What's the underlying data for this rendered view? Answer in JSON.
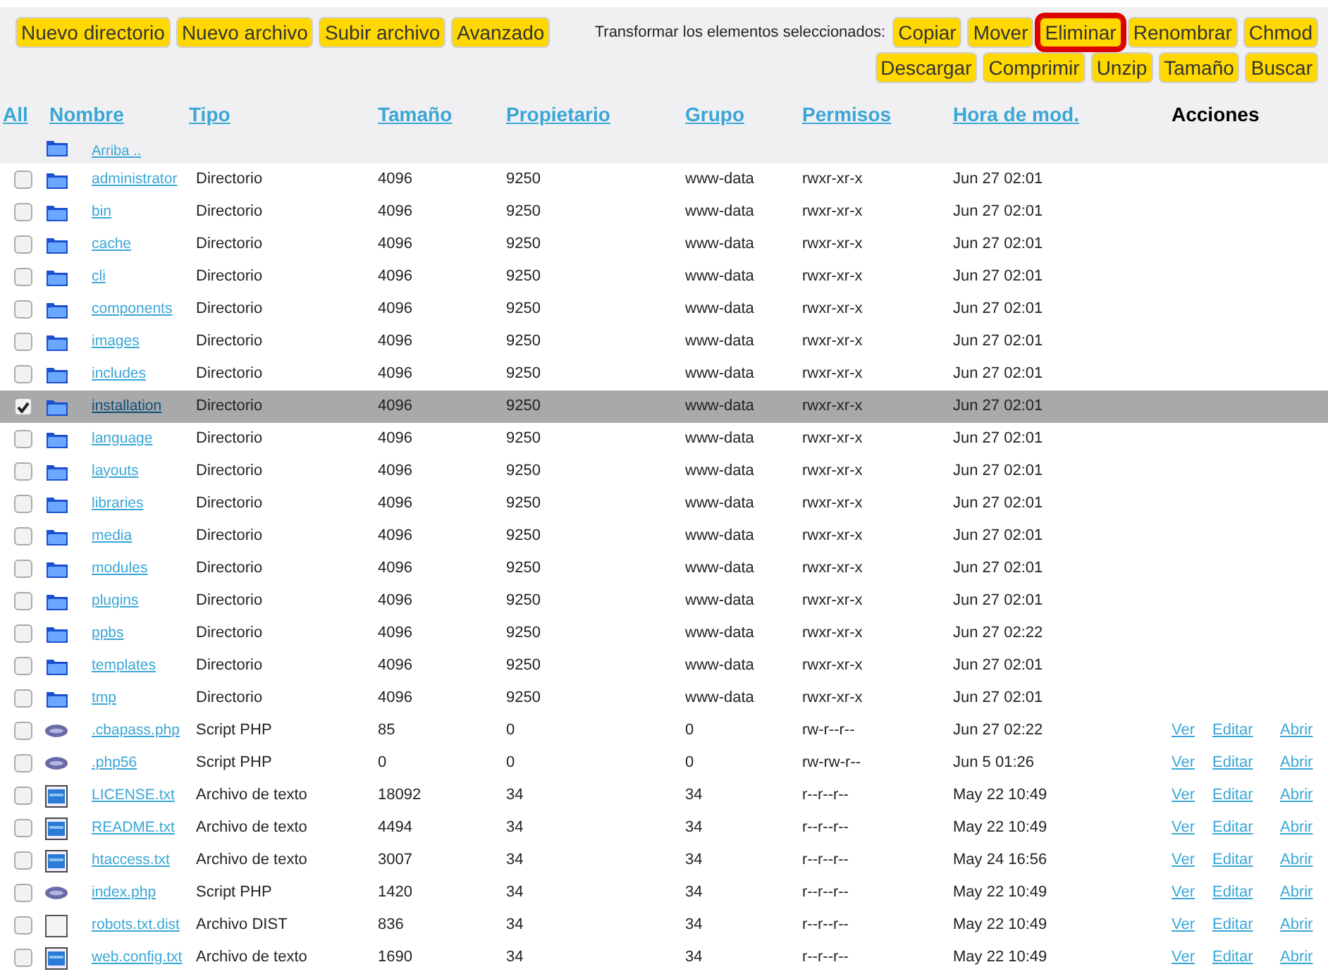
{
  "toolbar": {
    "left_buttons": [
      {
        "label": "Nuevo directorio",
        "highlighted": false
      },
      {
        "label": "Nuevo archivo",
        "highlighted": false
      },
      {
        "label": "Subir archivo",
        "highlighted": false
      },
      {
        "label": "Avanzado",
        "highlighted": false
      }
    ],
    "transform_label": "Transformar los elementos seleccionados:",
    "right_buttons_row1": [
      {
        "label": "Copiar",
        "highlighted": false
      },
      {
        "label": "Mover",
        "highlighted": false
      },
      {
        "label": "Eliminar",
        "highlighted": true
      },
      {
        "label": "Renombrar",
        "highlighted": false
      },
      {
        "label": "Chmod",
        "highlighted": false
      }
    ],
    "right_buttons_row2": [
      {
        "label": "Descargar",
        "highlighted": false
      },
      {
        "label": "Comprimir",
        "highlighted": false
      },
      {
        "label": "Unzip",
        "highlighted": false
      },
      {
        "label": "Tamaño",
        "highlighted": false
      },
      {
        "label": "Buscar",
        "highlighted": false
      }
    ]
  },
  "table": {
    "columns": [
      "All",
      "Nombre",
      "Tipo",
      "Tamaño",
      "Propietario",
      "Grupo",
      "Permisos",
      "Hora de mod.",
      "Acciones"
    ],
    "up_link": "Arriba ..",
    "rows": [
      {
        "kind": "dir",
        "checked": false,
        "name": "administrator",
        "type": "Directorio",
        "size": "4096",
        "owner": "9250",
        "group": "www-data",
        "perms": "rwxr-xr-x",
        "time": "Jun 27 02:01",
        "actions": []
      },
      {
        "kind": "dir",
        "checked": false,
        "name": "bin",
        "type": "Directorio",
        "size": "4096",
        "owner": "9250",
        "group": "www-data",
        "perms": "rwxr-xr-x",
        "time": "Jun 27 02:01",
        "actions": []
      },
      {
        "kind": "dir",
        "checked": false,
        "name": "cache",
        "type": "Directorio",
        "size": "4096",
        "owner": "9250",
        "group": "www-data",
        "perms": "rwxr-xr-x",
        "time": "Jun 27 02:01",
        "actions": []
      },
      {
        "kind": "dir",
        "checked": false,
        "name": "cli",
        "type": "Directorio",
        "size": "4096",
        "owner": "9250",
        "group": "www-data",
        "perms": "rwxr-xr-x",
        "time": "Jun 27 02:01",
        "actions": []
      },
      {
        "kind": "dir",
        "checked": false,
        "name": "components",
        "type": "Directorio",
        "size": "4096",
        "owner": "9250",
        "group": "www-data",
        "perms": "rwxr-xr-x",
        "time": "Jun 27 02:01",
        "actions": []
      },
      {
        "kind": "dir",
        "checked": false,
        "name": "images",
        "type": "Directorio",
        "size": "4096",
        "owner": "9250",
        "group": "www-data",
        "perms": "rwxr-xr-x",
        "time": "Jun 27 02:01",
        "actions": []
      },
      {
        "kind": "dir",
        "checked": false,
        "name": "includes",
        "type": "Directorio",
        "size": "4096",
        "owner": "9250",
        "group": "www-data",
        "perms": "rwxr-xr-x",
        "time": "Jun 27 02:01",
        "actions": []
      },
      {
        "kind": "dir",
        "checked": true,
        "name": "installation",
        "type": "Directorio",
        "size": "4096",
        "owner": "9250",
        "group": "www-data",
        "perms": "rwxr-xr-x",
        "time": "Jun 27 02:01",
        "actions": []
      },
      {
        "kind": "dir",
        "checked": false,
        "name": "language",
        "type": "Directorio",
        "size": "4096",
        "owner": "9250",
        "group": "www-data",
        "perms": "rwxr-xr-x",
        "time": "Jun 27 02:01",
        "actions": []
      },
      {
        "kind": "dir",
        "checked": false,
        "name": "layouts",
        "type": "Directorio",
        "size": "4096",
        "owner": "9250",
        "group": "www-data",
        "perms": "rwxr-xr-x",
        "time": "Jun 27 02:01",
        "actions": []
      },
      {
        "kind": "dir",
        "checked": false,
        "name": "libraries",
        "type": "Directorio",
        "size": "4096",
        "owner": "9250",
        "group": "www-data",
        "perms": "rwxr-xr-x",
        "time": "Jun 27 02:01",
        "actions": []
      },
      {
        "kind": "dir",
        "checked": false,
        "name": "media",
        "type": "Directorio",
        "size": "4096",
        "owner": "9250",
        "group": "www-data",
        "perms": "rwxr-xr-x",
        "time": "Jun 27 02:01",
        "actions": []
      },
      {
        "kind": "dir",
        "checked": false,
        "name": "modules",
        "type": "Directorio",
        "size": "4096",
        "owner": "9250",
        "group": "www-data",
        "perms": "rwxr-xr-x",
        "time": "Jun 27 02:01",
        "actions": []
      },
      {
        "kind": "dir",
        "checked": false,
        "name": "plugins",
        "type": "Directorio",
        "size": "4096",
        "owner": "9250",
        "group": "www-data",
        "perms": "rwxr-xr-x",
        "time": "Jun 27 02:01",
        "actions": []
      },
      {
        "kind": "dir",
        "checked": false,
        "name": "ppbs",
        "type": "Directorio",
        "size": "4096",
        "owner": "9250",
        "group": "www-data",
        "perms": "rwxr-xr-x",
        "time": "Jun 27 02:22",
        "actions": []
      },
      {
        "kind": "dir",
        "checked": false,
        "name": "templates",
        "type": "Directorio",
        "size": "4096",
        "owner": "9250",
        "group": "www-data",
        "perms": "rwxr-xr-x",
        "time": "Jun 27 02:01",
        "actions": []
      },
      {
        "kind": "dir",
        "checked": false,
        "name": "tmp",
        "type": "Directorio",
        "size": "4096",
        "owner": "9250",
        "group": "www-data",
        "perms": "rwxr-xr-x",
        "time": "Jun 27 02:01",
        "actions": []
      },
      {
        "kind": "php",
        "checked": false,
        "name": ".cbapass.php",
        "type": "Script PHP",
        "size": "85",
        "owner": "0",
        "group": "0",
        "perms": "rw-r--r--",
        "time": "Jun 27 02:22",
        "actions": [
          "Ver",
          "Editar",
          "Abrir"
        ]
      },
      {
        "kind": "php",
        "checked": false,
        "name": ".php56",
        "type": "Script PHP",
        "size": "0",
        "owner": "0",
        "group": "0",
        "perms": "rw-rw-r--",
        "time": "Jun 5 01:26",
        "actions": [
          "Ver",
          "Editar",
          "Abrir"
        ]
      },
      {
        "kind": "text",
        "checked": false,
        "name": "LICENSE.txt",
        "type": "Archivo de texto",
        "size": "18092",
        "owner": "34",
        "group": "34",
        "perms": "r--r--r--",
        "time": "May 22 10:49",
        "actions": [
          "Ver",
          "Editar",
          "Abrir"
        ]
      },
      {
        "kind": "text",
        "checked": false,
        "name": "README.txt",
        "type": "Archivo de texto",
        "size": "4494",
        "owner": "34",
        "group": "34",
        "perms": "r--r--r--",
        "time": "May 22 10:49",
        "actions": [
          "Ver",
          "Editar",
          "Abrir"
        ]
      },
      {
        "kind": "text",
        "checked": false,
        "name": "htaccess.txt",
        "type": "Archivo de texto",
        "size": "3007",
        "owner": "34",
        "group": "34",
        "perms": "r--r--r--",
        "time": "May 24 16:56",
        "actions": [
          "Ver",
          "Editar",
          "Abrir"
        ]
      },
      {
        "kind": "php",
        "checked": false,
        "name": "index.php",
        "type": "Script PHP",
        "size": "1420",
        "owner": "34",
        "group": "34",
        "perms": "r--r--r--",
        "time": "May 22 10:49",
        "actions": [
          "Ver",
          "Editar",
          "Abrir"
        ]
      },
      {
        "kind": "file",
        "checked": false,
        "name": "robots.txt.dist",
        "type": "Archivo DIST",
        "size": "836",
        "owner": "34",
        "group": "34",
        "perms": "r--r--r--",
        "time": "May 22 10:49",
        "actions": [
          "Ver",
          "Editar",
          "Abrir"
        ]
      },
      {
        "kind": "text",
        "checked": false,
        "name": "web.config.txt",
        "type": "Archivo de texto",
        "size": "1690",
        "owner": "34",
        "group": "34",
        "perms": "r--r--r--",
        "time": "May 22 10:49",
        "actions": [
          "Ver",
          "Editar",
          "Abrir"
        ]
      }
    ]
  }
}
